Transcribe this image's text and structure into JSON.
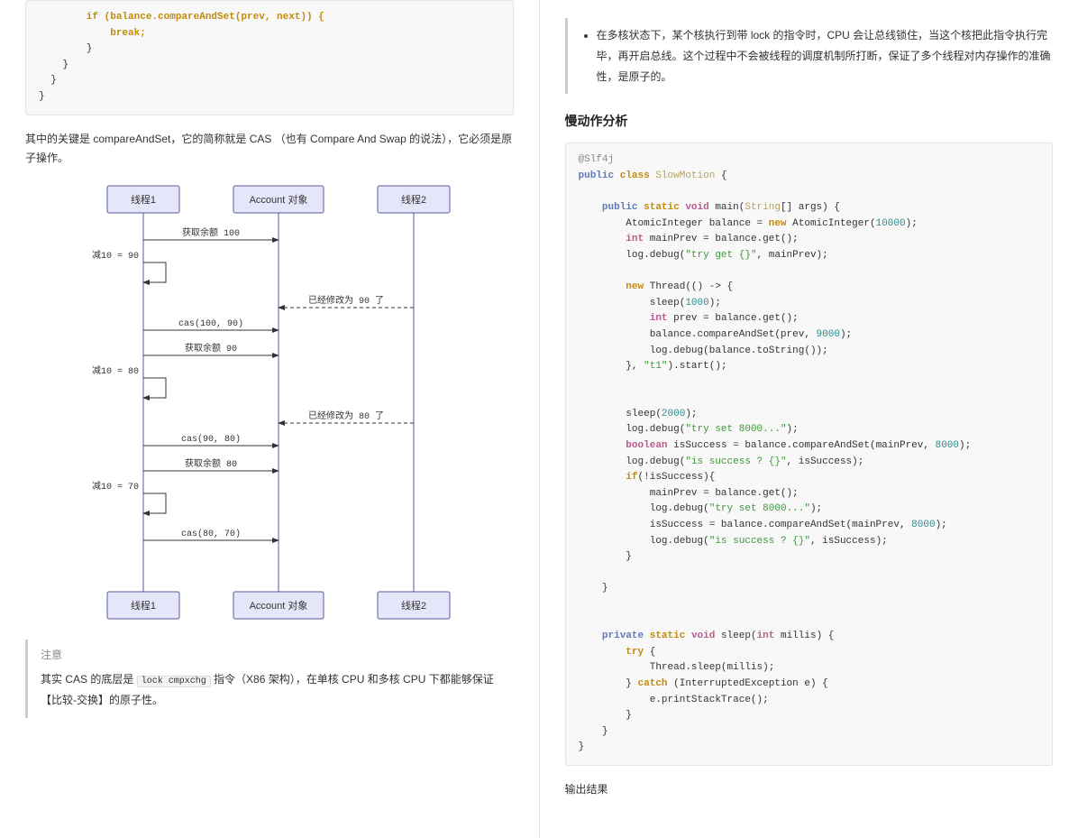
{
  "left": {
    "code1": {
      "l1": "        if (balance.compareAndSet(prev, next)) {",
      "l2": "            break;",
      "l3": "        }",
      "l4": "    }",
      "l5": "  }",
      "l6": "}"
    },
    "intro": "其中的关键是 compareAndSet，它的简称就是 CAS （也有 Compare And Swap 的说法），它必须是原子操作。",
    "seq": {
      "p1_top": "线程1",
      "p2_top": "Account 对象",
      "p3_top": "线程2",
      "p1_bot": "线程1",
      "p2_bot": "Account 对象",
      "p3_bot": "线程2",
      "m1": "获取余额 100",
      "s1": "减10 = 90",
      "r1": "已经修改为 90 了",
      "m2": "cas(100, 90)",
      "m3": "获取余额 90",
      "s2": "减10 = 80",
      "r2": "已经修改为 80 了",
      "m4": "cas(90, 80)",
      "m5": "获取余额 80",
      "s3": "减10 = 70",
      "m6": "cas(80, 70)"
    },
    "note_title": "注意",
    "note_body_a": "其实 CAS 的底层是 ",
    "note_code": "lock cmpxchg",
    "note_body_b": " 指令（X86 架构），在单核 CPU 和多核 CPU 下都能够保证【比较-交换】的原子性。"
  },
  "right": {
    "bullet": "在多核状态下，某个核执行到带 lock 的指令时，CPU 会让总线锁住，当这个核把此指令执行完毕，再开启总线。这个过程中不会被线程的调度机制所打断，保证了多个线程对内存操作的准确性，是原子的。",
    "h1": "慢动作分析",
    "out_label": "输出结果",
    "code2": {
      "l01a": "@Slf4j",
      "l02a": "public",
      "l02b": " class ",
      "l02c": "SlowMotion",
      "l02d": " {",
      "l03a": "    public",
      "l03b": " static ",
      "l03c": "void",
      "l03d": " main(",
      "l03e": "String",
      "l03f": "[] args) {",
      "l04a": "        AtomicInteger balance = ",
      "l04b": "new",
      "l04c": " AtomicInteger(",
      "l04d": "10000",
      "l04e": ");",
      "l05a": "        int",
      "l05b": " mainPrev = balance.get();",
      "l06a": "        log.debug(",
      "l06b": "\"try get {}\"",
      "l06c": ", mainPrev);",
      "l08a": "        new",
      "l08b": " Thread(() -> {",
      "l09a": "            sleep(",
      "l09b": "1000",
      "l09c": ");",
      "l10a": "            int",
      "l10b": " prev = balance.get();",
      "l11a": "            balance.compareAndSet(prev, ",
      "l11b": "9000",
      "l11c": ");",
      "l12a": "            log.debug(balance.toString());",
      "l13a": "        }, ",
      "l13b": "\"t1\"",
      "l13c": ").start();",
      "l16a": "        sleep(",
      "l16b": "2000",
      "l16c": ");",
      "l17a": "        log.debug(",
      "l17b": "\"try set 8000...\"",
      "l17c": ");",
      "l18a": "        boolean",
      "l18b": " isSuccess = balance.compareAndSet(mainPrev, ",
      "l18c": "8000",
      "l18d": ");",
      "l19a": "        log.debug(",
      "l19b": "\"is success ? {}\"",
      "l19c": ", isSuccess);",
      "l20a": "        if",
      "l20b": "(!isSuccess){",
      "l21a": "            mainPrev = balance.get();",
      "l22a": "            log.debug(",
      "l22b": "\"try set 8000...\"",
      "l22c": ");",
      "l23a": "            isSuccess = balance.compareAndSet(mainPrev, ",
      "l23b": "8000",
      "l23c": ");",
      "l24a": "            log.debug(",
      "l24b": "\"is success ? {}\"",
      "l24c": ", isSuccess);",
      "l25a": "        }",
      "l27a": "    }",
      "l30a": "    private",
      "l30b": " static ",
      "l30c": "void",
      "l30d": " sleep(",
      "l30e": "int",
      "l30f": " millis) {",
      "l31a": "        try",
      "l31b": " {",
      "l32a": "            Thread.sleep(millis);",
      "l33a": "        } ",
      "l33b": "catch",
      "l33c": " (InterruptedException e) {",
      "l34a": "            e.printStackTrace();",
      "l35a": "        }",
      "l36a": "    }",
      "l37a": "}"
    }
  }
}
